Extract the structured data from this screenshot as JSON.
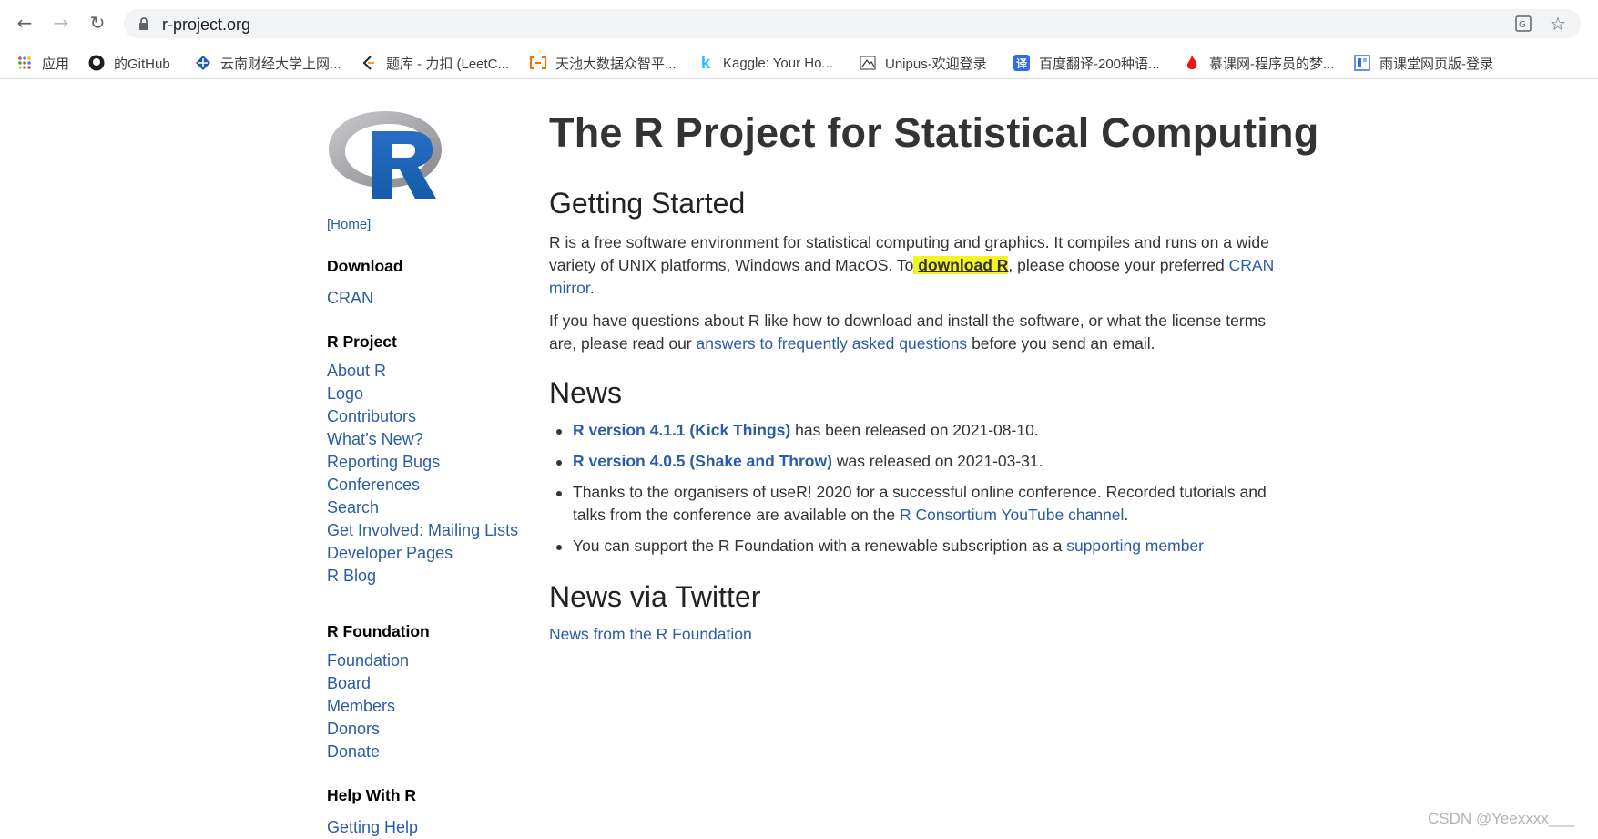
{
  "browser": {
    "url": "r-project.org",
    "bookmarks": [
      {
        "label": "应用",
        "icon": "apps-grid-icon"
      },
      {
        "label": "的GitHub",
        "icon": "github-icon"
      },
      {
        "label": "云南财经大学上网...",
        "icon": "university-icon"
      },
      {
        "label": "题库 - 力扣 (LeetC...",
        "icon": "leetcode-icon"
      },
      {
        "label": "天池大数据众智平...",
        "icon": "tianchi-icon"
      },
      {
        "label": "Kaggle: Your Ho...",
        "icon": "kaggle-icon"
      },
      {
        "label": "Unipus-欢迎登录",
        "icon": "unipus-icon"
      },
      {
        "label": "百度翻译-200种语...",
        "icon": "baidu-translate-icon"
      },
      {
        "label": "慕课网-程序员的梦...",
        "icon": "imooc-icon"
      },
      {
        "label": "雨课堂网页版-登录",
        "icon": "yuketang-icon"
      }
    ]
  },
  "sidebar": {
    "home": "[Home]",
    "download": {
      "heading": "Download",
      "links": [
        "CRAN"
      ]
    },
    "r_project": {
      "heading": "R Project",
      "links": [
        "About R",
        "Logo",
        "Contributors",
        "What’s New?",
        "Reporting Bugs",
        "Conferences",
        "Search",
        "Get Involved: Mailing Lists",
        "Developer Pages",
        "R Blog"
      ]
    },
    "r_foundation": {
      "heading": "R Foundation",
      "links": [
        "Foundation",
        "Board",
        "Members",
        "Donors",
        "Donate"
      ]
    },
    "help": {
      "heading": "Help With R",
      "links": [
        "Getting Help"
      ]
    }
  },
  "main": {
    "title": "The R Project for Statistical Computing",
    "getting_started": {
      "heading": "Getting Started",
      "p1_a": "R is a free software environment for statistical computing and graphics. It compiles and runs on a wide variety of UNIX platforms, Windows and MacOS. To",
      "p1_link": "download R",
      "p1_b": ", please choose your preferred",
      "p1_link2": "CRAN mirror",
      "p1_c": ".",
      "p2_a": "If you have questions about R like how to download and install the software, or what the license terms are, please read our",
      "p2_link": "answers to frequently asked questions",
      "p2_b": "before you send an email."
    },
    "news": {
      "heading": "News",
      "items": [
        {
          "link": "R version 4.1.1 (Kick Things)",
          "text": "has been released on 2021-08-10."
        },
        {
          "link": "R version 4.0.5 (Shake and Throw)",
          "text": "was released on 2021-03-31."
        },
        {
          "text_a": "Thanks to the organisers of useR! 2020 for a successful online conference. Recorded tutorials and talks from the conference are available on the",
          "link": "R Consortium YouTube channel",
          "text_b": "."
        },
        {
          "text_a": "You can support the R Foundation with a renewable subscription as a",
          "link": "supporting member"
        }
      ]
    },
    "twitter": {
      "heading": "News via Twitter",
      "link": "News from the R Foundation"
    }
  },
  "watermark": "CSDN @Yeexxxx___"
}
